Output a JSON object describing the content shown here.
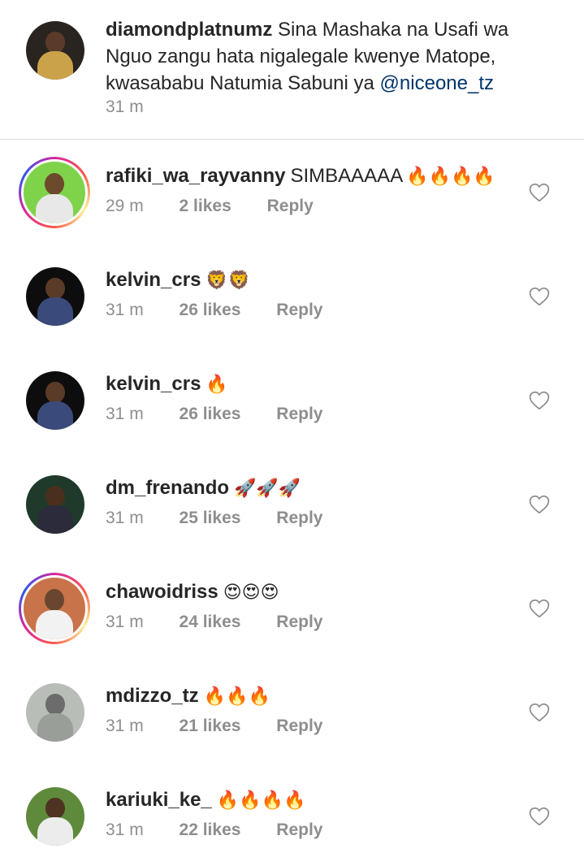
{
  "caption": {
    "username": "diamondplatnumz",
    "text": "Sina Mashaka na Usafi wa Nguo zangu hata nigalegale kwenye Matope, kwasababu Natumia Sabuni ya",
    "mention": "@niceone_tz",
    "time": "31 m"
  },
  "comments": [
    {
      "username": "rafiki_wa_rayvanny",
      "text": "SIMBAAAAA",
      "emoji": "🔥🔥🔥🔥",
      "time": "29 m",
      "likes": "2 likes",
      "reply": "Reply",
      "story_ring": true,
      "avatar_colors": {
        "bg": "#7fd34a",
        "head": "#6b4a2e",
        "body": "#e8e8e8"
      }
    },
    {
      "username": "kelvin_crs",
      "text": "",
      "emoji": "🦁🦁",
      "time": "31 m",
      "likes": "26 likes",
      "reply": "Reply",
      "story_ring": false,
      "avatar_colors": {
        "bg": "#0d0d0d",
        "head": "#5a3b28",
        "body": "#3a4a7a"
      }
    },
    {
      "username": "kelvin_crs",
      "text": "",
      "emoji": "🔥",
      "time": "31 m",
      "likes": "26 likes",
      "reply": "Reply",
      "story_ring": false,
      "avatar_colors": {
        "bg": "#0d0d0d",
        "head": "#5a3b28",
        "body": "#3a4a7a"
      }
    },
    {
      "username": "dm_frenando",
      "text": "",
      "emoji": "🚀🚀🚀",
      "time": "31 m",
      "likes": "25 likes",
      "reply": "Reply",
      "story_ring": false,
      "avatar_colors": {
        "bg": "#1f3a2a",
        "head": "#4a2f1e",
        "body": "#2b2b3b"
      }
    },
    {
      "username": "chawoidriss",
      "text": "",
      "emoji": "😍😍😍",
      "time": "31 m",
      "likes": "24 likes",
      "reply": "Reply",
      "story_ring": true,
      "avatar_colors": {
        "bg": "#c8734a",
        "head": "#6a4630",
        "body": "#f2f2f2"
      }
    },
    {
      "username": "mdizzo_tz",
      "text": "",
      "emoji": "🔥🔥🔥",
      "time": "31 m",
      "likes": "21 likes",
      "reply": "Reply",
      "story_ring": false,
      "avatar_colors": {
        "bg": "#b9bdb8",
        "head": "#6c6c6c",
        "body": "#9a9e98"
      }
    },
    {
      "username": "kariuki_ke_",
      "text": "",
      "emoji": "🔥🔥🔥🔥",
      "time": "31 m",
      "likes": "22 likes",
      "reply": "Reply",
      "story_ring": false,
      "avatar_colors": {
        "bg": "#5f8a3c",
        "head": "#4e3322",
        "body": "#ececec"
      }
    }
  ],
  "icons": {
    "like": "heart-outline-icon"
  },
  "colors": {
    "text": "#262626",
    "secondary": "#8e8e8e",
    "mention": "#003569",
    "divider": "#dbdbdb"
  }
}
